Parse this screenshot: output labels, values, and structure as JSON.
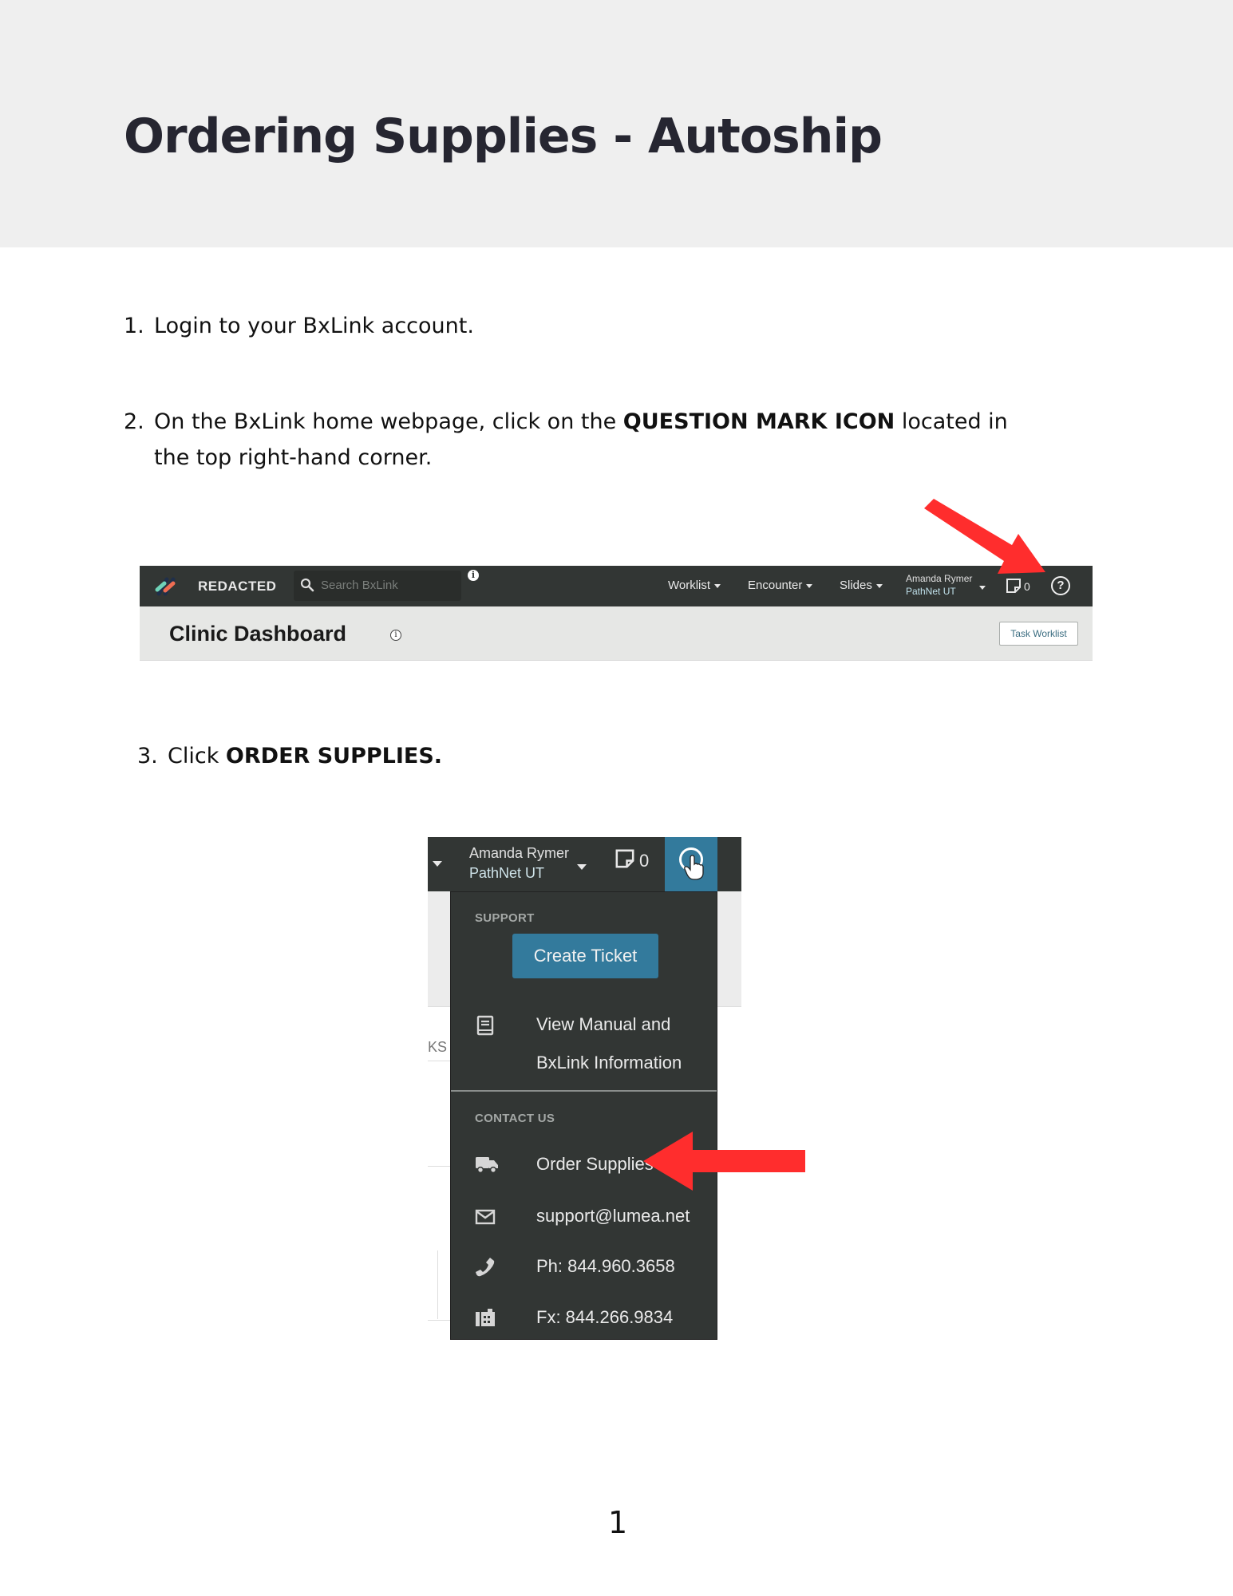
{
  "title": "Ordering Supplies - Autoship",
  "steps": [
    {
      "number": "1.",
      "text": "Login to your BxLink account."
    },
    {
      "number": "2.",
      "text_before": "On the BxLink home webpage, click on the ",
      "bold": "QUESTION MARK ICON",
      "text_after": " located in",
      "text_line2": "the top right-hand corner."
    },
    {
      "number": "3.",
      "text_before": "Click ",
      "bold": "ORDER SUPPLIES."
    }
  ],
  "navbar": {
    "brand": "REDACTED",
    "search_placeholder": "Search BxLink",
    "info_glyph": "i",
    "links": [
      "Worklist",
      "Encounter",
      "Slides"
    ],
    "user_name": "Amanda Rymer",
    "user_org": "PathNet UT",
    "notes_count": "0",
    "help_glyph": "?"
  },
  "dashboard": {
    "title": "Clinic Dashboard",
    "info_glyph": "i",
    "task_button": "Task Worklist"
  },
  "help_menu": {
    "user_name": "Amanda Rymer",
    "user_org": "PathNet UT",
    "notes_count": "0",
    "background_fragment": "KS",
    "support_heading": "SUPPORT",
    "create_ticket": "Create Ticket",
    "manual_line1": "View Manual and",
    "manual_line2": "BxLink Information",
    "contact_heading": "CONTACT US",
    "order_supplies": "Order Supplies",
    "email": "support@lumea.net",
    "phone": "Ph: 844.960.3658",
    "fax": "Fx: 844.266.9834"
  },
  "colors": {
    "arrow": "#ff2d2d",
    "accent": "#337a9c",
    "navbar": "#323634"
  },
  "page_number": "1"
}
